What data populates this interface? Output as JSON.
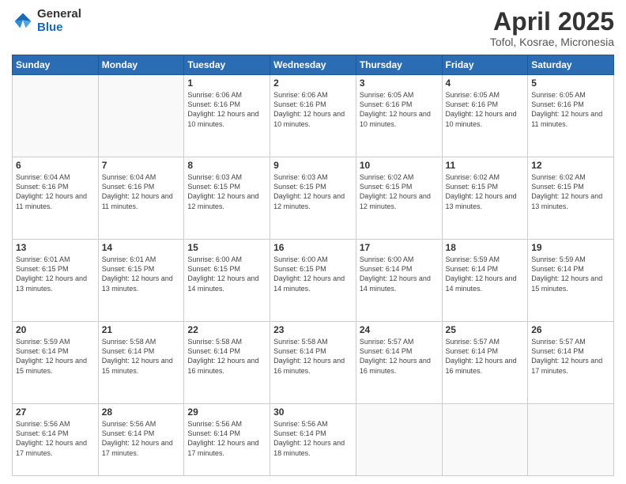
{
  "logo": {
    "general": "General",
    "blue": "Blue"
  },
  "title": "April 2025",
  "subtitle": "Tofol, Kosrae, Micronesia",
  "days_of_week": [
    "Sunday",
    "Monday",
    "Tuesday",
    "Wednesday",
    "Thursday",
    "Friday",
    "Saturday"
  ],
  "weeks": [
    [
      {
        "day": "",
        "info": ""
      },
      {
        "day": "",
        "info": ""
      },
      {
        "day": "1",
        "info": "Sunrise: 6:06 AM\nSunset: 6:16 PM\nDaylight: 12 hours and 10 minutes."
      },
      {
        "day": "2",
        "info": "Sunrise: 6:06 AM\nSunset: 6:16 PM\nDaylight: 12 hours and 10 minutes."
      },
      {
        "day": "3",
        "info": "Sunrise: 6:05 AM\nSunset: 6:16 PM\nDaylight: 12 hours and 10 minutes."
      },
      {
        "day": "4",
        "info": "Sunrise: 6:05 AM\nSunset: 6:16 PM\nDaylight: 12 hours and 10 minutes."
      },
      {
        "day": "5",
        "info": "Sunrise: 6:05 AM\nSunset: 6:16 PM\nDaylight: 12 hours and 11 minutes."
      }
    ],
    [
      {
        "day": "6",
        "info": "Sunrise: 6:04 AM\nSunset: 6:16 PM\nDaylight: 12 hours and 11 minutes."
      },
      {
        "day": "7",
        "info": "Sunrise: 6:04 AM\nSunset: 6:16 PM\nDaylight: 12 hours and 11 minutes."
      },
      {
        "day": "8",
        "info": "Sunrise: 6:03 AM\nSunset: 6:15 PM\nDaylight: 12 hours and 12 minutes."
      },
      {
        "day": "9",
        "info": "Sunrise: 6:03 AM\nSunset: 6:15 PM\nDaylight: 12 hours and 12 minutes."
      },
      {
        "day": "10",
        "info": "Sunrise: 6:02 AM\nSunset: 6:15 PM\nDaylight: 12 hours and 12 minutes."
      },
      {
        "day": "11",
        "info": "Sunrise: 6:02 AM\nSunset: 6:15 PM\nDaylight: 12 hours and 13 minutes."
      },
      {
        "day": "12",
        "info": "Sunrise: 6:02 AM\nSunset: 6:15 PM\nDaylight: 12 hours and 13 minutes."
      }
    ],
    [
      {
        "day": "13",
        "info": "Sunrise: 6:01 AM\nSunset: 6:15 PM\nDaylight: 12 hours and 13 minutes."
      },
      {
        "day": "14",
        "info": "Sunrise: 6:01 AM\nSunset: 6:15 PM\nDaylight: 12 hours and 13 minutes."
      },
      {
        "day": "15",
        "info": "Sunrise: 6:00 AM\nSunset: 6:15 PM\nDaylight: 12 hours and 14 minutes."
      },
      {
        "day": "16",
        "info": "Sunrise: 6:00 AM\nSunset: 6:15 PM\nDaylight: 12 hours and 14 minutes."
      },
      {
        "day": "17",
        "info": "Sunrise: 6:00 AM\nSunset: 6:14 PM\nDaylight: 12 hours and 14 minutes."
      },
      {
        "day": "18",
        "info": "Sunrise: 5:59 AM\nSunset: 6:14 PM\nDaylight: 12 hours and 14 minutes."
      },
      {
        "day": "19",
        "info": "Sunrise: 5:59 AM\nSunset: 6:14 PM\nDaylight: 12 hours and 15 minutes."
      }
    ],
    [
      {
        "day": "20",
        "info": "Sunrise: 5:59 AM\nSunset: 6:14 PM\nDaylight: 12 hours and 15 minutes."
      },
      {
        "day": "21",
        "info": "Sunrise: 5:58 AM\nSunset: 6:14 PM\nDaylight: 12 hours and 15 minutes."
      },
      {
        "day": "22",
        "info": "Sunrise: 5:58 AM\nSunset: 6:14 PM\nDaylight: 12 hours and 16 minutes."
      },
      {
        "day": "23",
        "info": "Sunrise: 5:58 AM\nSunset: 6:14 PM\nDaylight: 12 hours and 16 minutes."
      },
      {
        "day": "24",
        "info": "Sunrise: 5:57 AM\nSunset: 6:14 PM\nDaylight: 12 hours and 16 minutes."
      },
      {
        "day": "25",
        "info": "Sunrise: 5:57 AM\nSunset: 6:14 PM\nDaylight: 12 hours and 16 minutes."
      },
      {
        "day": "26",
        "info": "Sunrise: 5:57 AM\nSunset: 6:14 PM\nDaylight: 12 hours and 17 minutes."
      }
    ],
    [
      {
        "day": "27",
        "info": "Sunrise: 5:56 AM\nSunset: 6:14 PM\nDaylight: 12 hours and 17 minutes."
      },
      {
        "day": "28",
        "info": "Sunrise: 5:56 AM\nSunset: 6:14 PM\nDaylight: 12 hours and 17 minutes."
      },
      {
        "day": "29",
        "info": "Sunrise: 5:56 AM\nSunset: 6:14 PM\nDaylight: 12 hours and 17 minutes."
      },
      {
        "day": "30",
        "info": "Sunrise: 5:56 AM\nSunset: 6:14 PM\nDaylight: 12 hours and 18 minutes."
      },
      {
        "day": "",
        "info": ""
      },
      {
        "day": "",
        "info": ""
      },
      {
        "day": "",
        "info": ""
      }
    ]
  ]
}
